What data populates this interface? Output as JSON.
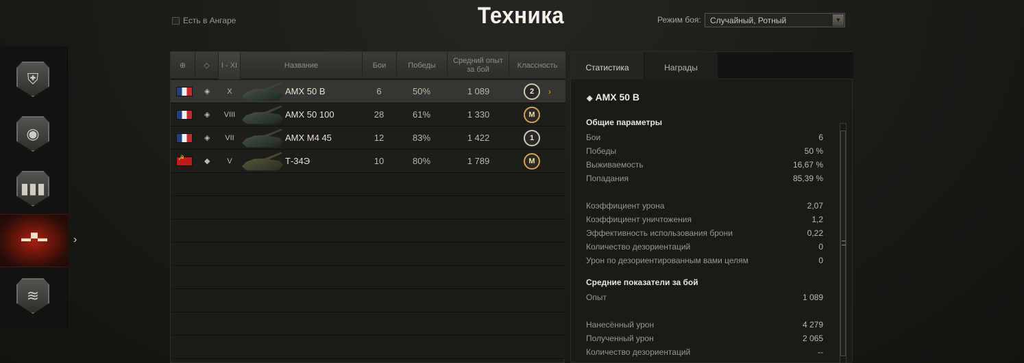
{
  "header": {
    "title": "Техника",
    "in_hangar_label": "Есть в Ангаре",
    "battle_mode_label": "Режим боя:",
    "battle_mode_value": "Случайный, Ротный"
  },
  "sidebar": {
    "items": [
      {
        "icon": "profile-icon"
      },
      {
        "icon": "medal-icon"
      },
      {
        "icon": "statistics-icon"
      },
      {
        "icon": "tank-icon",
        "active": true
      },
      {
        "icon": "layers-icon"
      }
    ]
  },
  "table": {
    "headers": {
      "nation": "globe-icon",
      "type": "vehicle-type-icon",
      "tier": "I - XI",
      "name": "Название",
      "battles": "Бои",
      "wins": "Победы",
      "avg_exp": "Средний опыт за бой",
      "mastery": "Классность"
    },
    "rows": [
      {
        "nation": "France",
        "tier": "X",
        "name": "AMX 50 B",
        "battles": "6",
        "wins": "50%",
        "avg_exp": "1 089",
        "mastery": "2",
        "selected": true
      },
      {
        "nation": "France",
        "tier": "VIII",
        "name": "AMX 50 100",
        "battles": "28",
        "wins": "61%",
        "avg_exp": "1 330",
        "mastery": "M"
      },
      {
        "nation": "France",
        "tier": "VII",
        "name": "AMX M4 45",
        "battles": "12",
        "wins": "83%",
        "avg_exp": "1 422",
        "mastery": "1"
      },
      {
        "nation": "USSR",
        "tier": "V",
        "name": "Т-34Э",
        "battles": "10",
        "wins": "80%",
        "avg_exp": "1 789",
        "mastery": "M"
      }
    ]
  },
  "detail": {
    "tabs": [
      "Статистика",
      "Награды"
    ],
    "vehicle_name": "AMX 50 B",
    "general_title": "Общие параметры",
    "general": [
      {
        "label": "Бои",
        "value": "6"
      },
      {
        "label": "Победы",
        "value": "50 %"
      },
      {
        "label": "Выживаемость",
        "value": "16,67 %"
      },
      {
        "label": "Попадания",
        "value": "85,39 %"
      }
    ],
    "ratios": [
      {
        "label": "Коэффициент урона",
        "value": "2,07"
      },
      {
        "label": "Коэффициент уничтожения",
        "value": "1,2"
      },
      {
        "label": "Эффективность использования брони",
        "value": "0,22"
      },
      {
        "label": "Количество дезориентаций",
        "value": "0"
      },
      {
        "label": "Урон по дезориентированным вами целям",
        "value": "0"
      }
    ],
    "avg_title": "Средние показатели за бой",
    "avg_exp": {
      "label": "Опыт",
      "value": "1 089"
    },
    "damage": [
      {
        "label": "Нанесённый урон",
        "value": "4 279"
      },
      {
        "label": "Полученный урон",
        "value": "2 065"
      },
      {
        "label": "Количество дезориентаций",
        "value": "--"
      }
    ]
  }
}
